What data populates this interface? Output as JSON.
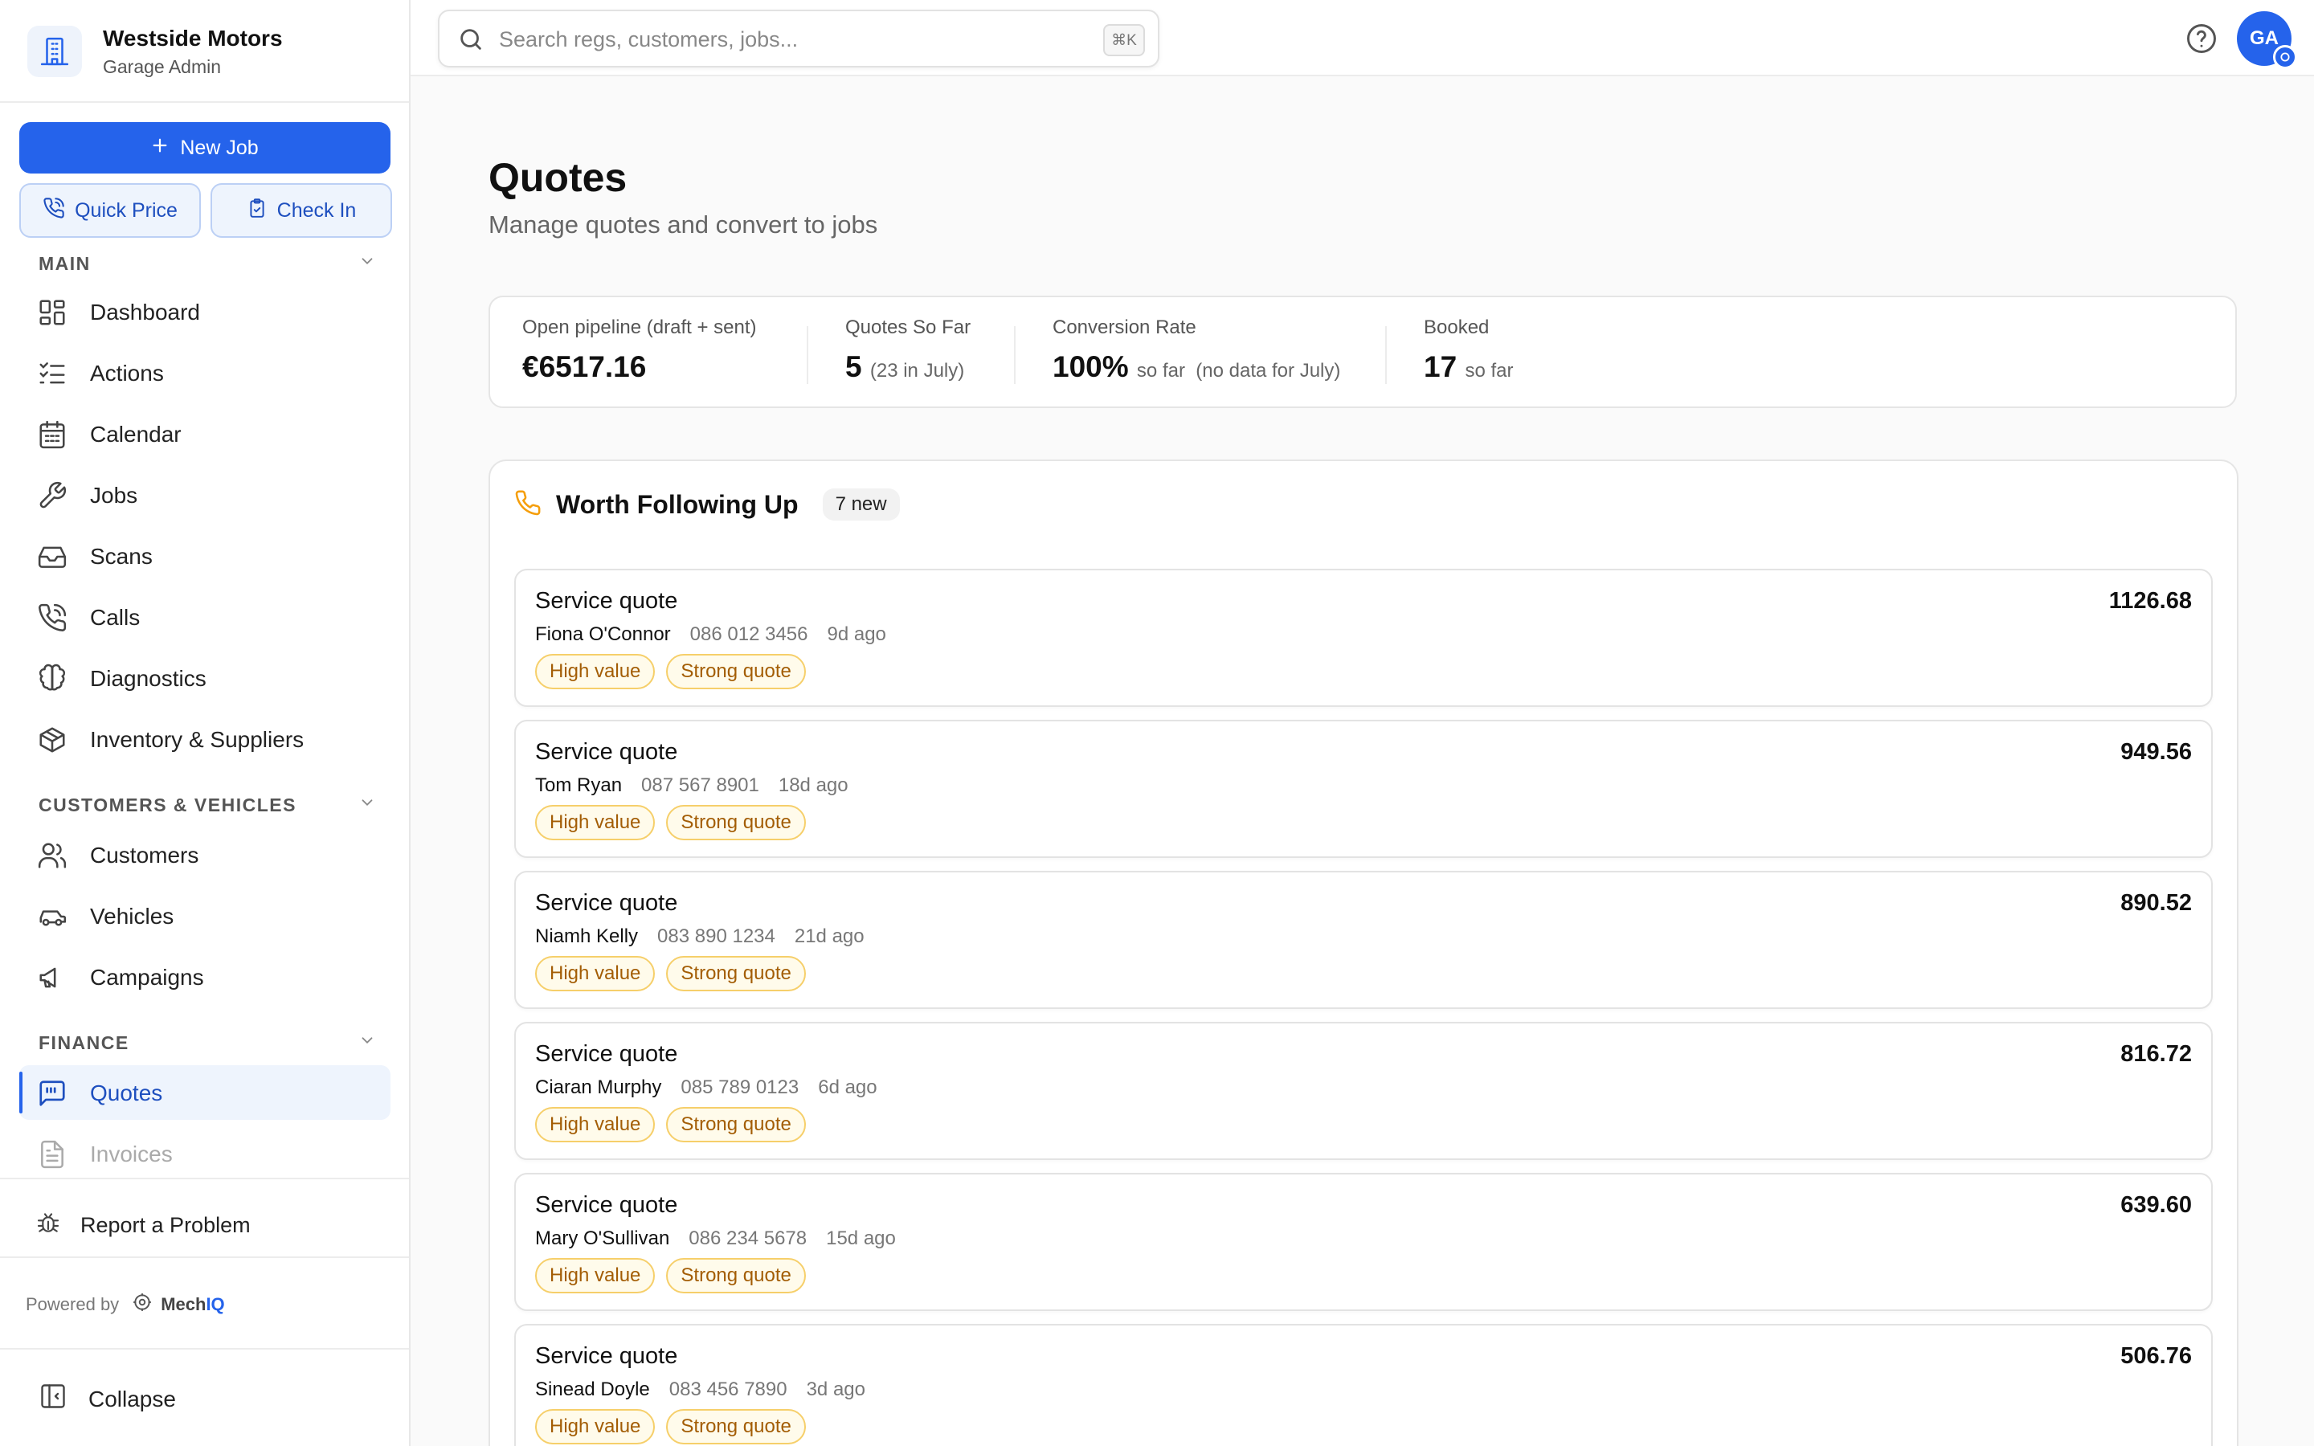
{
  "brand": {
    "name": "Westside Motors",
    "subtitle": "Garage Admin"
  },
  "actions": {
    "new_job": "New Job",
    "quick_price": "Quick Price",
    "check_in": "Check In"
  },
  "sidebar": {
    "sections": [
      {
        "title": "MAIN"
      },
      {
        "title": "CUSTOMERS & VEHICLES"
      },
      {
        "title": "FINANCE"
      }
    ],
    "items": [
      {
        "label": "Dashboard"
      },
      {
        "label": "Actions"
      },
      {
        "label": "Calendar"
      },
      {
        "label": "Jobs"
      },
      {
        "label": "Scans"
      },
      {
        "label": "Calls"
      },
      {
        "label": "Diagnostics"
      },
      {
        "label": "Inventory & Suppliers"
      },
      {
        "label": "Customers"
      },
      {
        "label": "Vehicles"
      },
      {
        "label": "Campaigns"
      },
      {
        "label": "Quotes",
        "active": true
      },
      {
        "label": "Invoices"
      }
    ],
    "report_problem": "Report a Problem",
    "powered_by": "Powered by",
    "powered_brand_a": "Mech",
    "powered_brand_b": "IQ",
    "collapse": "Collapse"
  },
  "search": {
    "placeholder": "Search regs, customers, jobs...",
    "shortcut": "⌘K"
  },
  "user": {
    "initials": "GA"
  },
  "page": {
    "title": "Quotes",
    "subtitle": "Manage quotes and convert to jobs"
  },
  "stats": [
    {
      "label": "Open pipeline (draft + sent)",
      "value": "€6517.16",
      "note": ""
    },
    {
      "label": "Quotes So Far",
      "value": "5",
      "note": "(23 in July)"
    },
    {
      "label": "Conversion Rate",
      "value": "100%",
      "note": "so far  (no data for July)"
    },
    {
      "label": "Booked",
      "value": "17",
      "note": "so far"
    }
  ],
  "follow_up": {
    "title": "Worth Following Up",
    "badge": "7 new",
    "quotes": [
      {
        "title": "Service quote",
        "name": "Fiona O'Connor",
        "phone": "086 012 3456",
        "ago": "9d ago",
        "amount": "1126.68",
        "tags": [
          "High value",
          "Strong quote"
        ]
      },
      {
        "title": "Service quote",
        "name": "Tom Ryan",
        "phone": "087 567 8901",
        "ago": "18d ago",
        "amount": "949.56",
        "tags": [
          "High value",
          "Strong quote"
        ]
      },
      {
        "title": "Service quote",
        "name": "Niamh Kelly",
        "phone": "083 890 1234",
        "ago": "21d ago",
        "amount": "890.52",
        "tags": [
          "High value",
          "Strong quote"
        ]
      },
      {
        "title": "Service quote",
        "name": "Ciaran Murphy",
        "phone": "085 789 0123",
        "ago": "6d ago",
        "amount": "816.72",
        "tags": [
          "High value",
          "Strong quote"
        ]
      },
      {
        "title": "Service quote",
        "name": "Mary O'Sullivan",
        "phone": "086 234 5678",
        "ago": "15d ago",
        "amount": "639.60",
        "tags": [
          "High value",
          "Strong quote"
        ]
      },
      {
        "title": "Service quote",
        "name": "Sinead Doyle",
        "phone": "083 456 7890",
        "ago": "3d ago",
        "amount": "506.76",
        "tags": [
          "High value",
          "Strong quote"
        ]
      }
    ]
  },
  "colors": {
    "accent": "#2563eb",
    "tag_border": "#f6cf6a",
    "tag_text": "#a35d05",
    "phone_icon": "#f59e0b"
  }
}
